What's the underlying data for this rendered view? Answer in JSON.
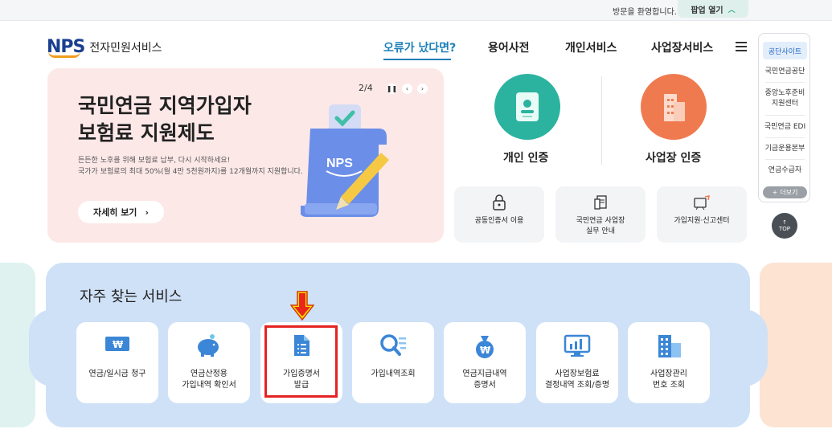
{
  "topbar": {
    "welcome": "방문을 환영합니다.",
    "popup_label": "팝업 열기",
    "popup_chevron": "^"
  },
  "brand": {
    "logo_mark": "NPS",
    "service_name": "전자민원서비스"
  },
  "gnb": {
    "items": [
      {
        "label": "오류가 났다면?"
      },
      {
        "label": "용어사전"
      },
      {
        "label": "개인서비스"
      },
      {
        "label": "사업장서비스"
      }
    ]
  },
  "hero": {
    "pager": "2/4",
    "title_line1": "국민연금 지역가입자",
    "title_line2": "보험료 지원제도",
    "desc_line1": "든든한 노후를 위해 보험료 납부, 다시 시작하세요!",
    "desc_line2": "국가가 보험료의 최대 50%(월 4만 5천원까지)를 12개월까지 지원합니다.",
    "more_label": "자세히 보기",
    "illus_text": "NPS"
  },
  "auth": {
    "personal": "개인 인증",
    "business": "사업장 인증"
  },
  "service_cards": [
    {
      "label": "공동인증서 이용",
      "icon": "lock-icon"
    },
    {
      "label": "국민연금 사업장 실무 안내",
      "line1": "국민연금 사업장",
      "line2": "실무 안내",
      "icon": "document-icon"
    },
    {
      "label": "가입지원·신고센터",
      "icon": "support-center-icon"
    }
  ],
  "quick_panel": {
    "head": "공단사이트",
    "items": [
      "국민연금공단",
      "중앙노후준비",
      "지원센터",
      "국민연금 EDI",
      "기금운용본부",
      "연금수급자"
    ],
    "more": "더보기",
    "top": "TOP"
  },
  "frequent": {
    "title": "자주 찾는 서비스",
    "cards": [
      {
        "line1": "연금/일시금 청구",
        "line2": "",
        "icon": "won-card-icon"
      },
      {
        "line1": "연금산정용",
        "line2": "가입내역 확인서",
        "icon": "piggy-bank-icon"
      },
      {
        "line1": "가입증명서",
        "line2": "발급",
        "icon": "certificate-icon"
      },
      {
        "line1": "가입내역조회",
        "line2": "",
        "icon": "search-list-icon"
      },
      {
        "line1": "연금지급내역",
        "line2": "증명서",
        "icon": "money-bag-icon"
      },
      {
        "line1": "사업장보험료",
        "line2": "결정내역 조회/증명",
        "icon": "monitor-chart-icon"
      },
      {
        "line1": "사업장관리",
        "line2": "번호 조회",
        "icon": "building-icon"
      }
    ]
  },
  "colors": {
    "accent_blue": "#1b7fb8",
    "highlight_red": "#e52222",
    "arrow_yellow": "#ffe600",
    "teal": "#2bb3a0",
    "orange": "#f07a4f"
  }
}
